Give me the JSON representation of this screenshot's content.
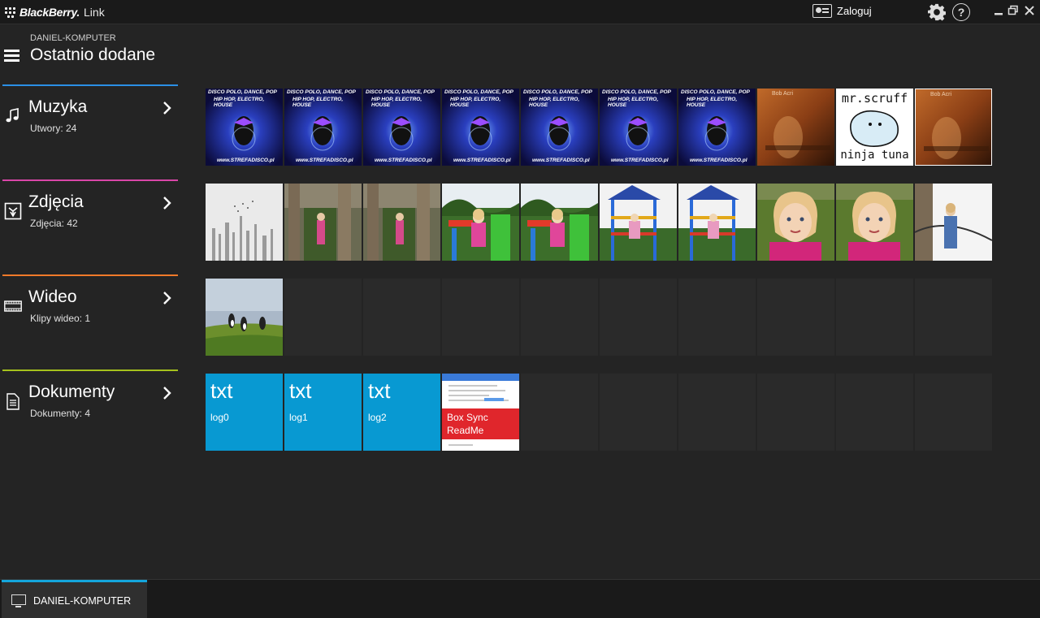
{
  "app": {
    "brand": "BlackBerry.",
    "product": "Link"
  },
  "titlebar": {
    "login_label": "Zaloguj",
    "help_glyph": "?"
  },
  "header": {
    "device_name": "DANIEL-KOMPUTER",
    "title": "Ostatnio dodane"
  },
  "colors": {
    "music": "#2b8fe6",
    "photos": "#d946a8",
    "videos": "#f07a2a",
    "documents": "#a6c21d",
    "text_tile": "#0899d2",
    "pdf_band": "#e0262c",
    "active_tab": "#14a5dc"
  },
  "categories": [
    {
      "key": "music",
      "title": "Muzyka",
      "count": "Utwory: 24",
      "icon": "music-note-icon"
    },
    {
      "key": "photos",
      "title": "Zdjęcia",
      "count": "Zdjęcia: 42",
      "icon": "photo-icon"
    },
    {
      "key": "videos",
      "title": "Wideo",
      "count": "Klipy wideo: 1",
      "icon": "film-icon"
    },
    {
      "key": "documents",
      "title": "Dokumenty",
      "count": "Dokumenty: 4",
      "icon": "document-icon"
    }
  ],
  "music_covers": [
    {
      "caption_top": "DISCO POLO, DANCE, POP",
      "caption_mid": "HIP HOP, ELECTRO, HOUSE",
      "caption_bottom": "www.STREFADISCO.pl"
    },
    {
      "caption_top": "DISCO POLO, DANCE, POP",
      "caption_mid": "HIP HOP, ELECTRO, HOUSE",
      "caption_bottom": "www.STREFADISCO.pl"
    },
    {
      "caption_top": "DISCO POLO, DANCE, POP",
      "caption_mid": "HIP HOP, ELECTRO, HOUSE",
      "caption_bottom": "www.STREFADISCO.pl"
    },
    {
      "caption_top": "DISCO POLO, DANCE, POP",
      "caption_mid": "HIP HOP, ELECTRO, HOUSE",
      "caption_bottom": "www.STREFADISCO.pl"
    },
    {
      "caption_top": "DISCO POLO, DANCE, POP",
      "caption_mid": "HIP HOP, ELECTRO, HOUSE",
      "caption_bottom": "www.STREFADISCO.pl"
    },
    {
      "caption_top": "DISCO POLO, DANCE, POP",
      "caption_mid": "HIP HOP, ELECTRO, HOUSE",
      "caption_bottom": "www.STREFADISCO.pl"
    },
    {
      "caption_top": "DISCO POLO, DANCE, POP",
      "caption_mid": "HIP HOP, ELECTRO, HOUSE",
      "caption_bottom": "www.STREFADISCO.pl"
    },
    {
      "caption_top": "Bob Acri"
    },
    {
      "caption_top": "mr.scruff",
      "caption_bottom": "ninja tuna"
    },
    {
      "caption_top": "Bob Acri"
    }
  ],
  "documents": [
    {
      "type": "txt",
      "ext": "txt",
      "name": "log0"
    },
    {
      "type": "txt",
      "ext": "txt",
      "name": "log1"
    },
    {
      "type": "txt",
      "ext": "txt",
      "name": "log2"
    },
    {
      "type": "pdf",
      "name": "Box Sync ReadMe"
    }
  ],
  "bottom": {
    "device_tab_label": "DANIEL-KOMPUTER"
  }
}
